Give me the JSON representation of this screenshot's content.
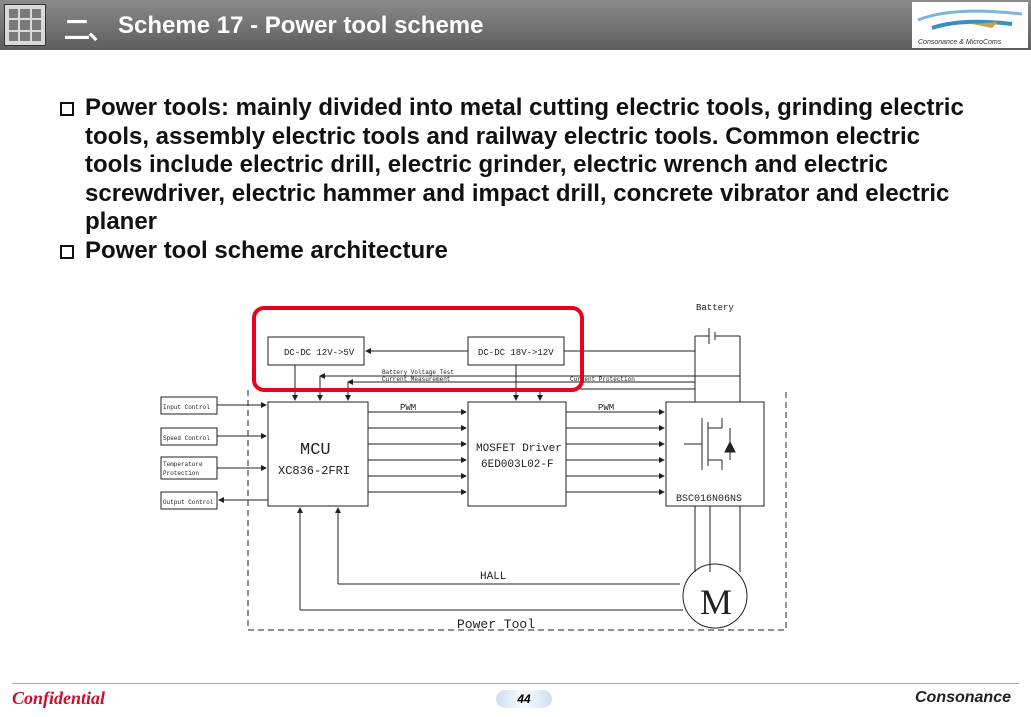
{
  "header": {
    "section_number": "二、",
    "title": "Scheme 17 - Power tool scheme",
    "logo_text": "Consonance & MicroComs"
  },
  "bullets": [
    "Power tools: mainly divided into metal cutting electric tools, grinding electric tools, assembly electric tools and railway electric tools. Common electric tools include electric drill, electric grinder, electric wrench and electric screwdriver, electric hammer and impact drill, concrete vibrator and electric planer",
    "Power tool scheme architecture"
  ],
  "diagram": {
    "battery": "Battery",
    "dcdc_5v": "DC-DC 12V->5V",
    "dcdc_12v": "DC-DC 18V->12V",
    "battery_voltage": "Battery Voltage Test",
    "current_measurement": "Current Measurement",
    "current_protection": "Current Protection",
    "inputs": [
      "Input Control",
      "Speed Control",
      "Temperature",
      "Protection",
      "Output Control"
    ],
    "pwm_left": "PWM",
    "pwm_right": "PWM",
    "mcu_title": "MCU",
    "mcu_part": "XC836-2FRI",
    "driver_title": "MOSFET Driver",
    "driver_part": "6ED003L02-F",
    "mosfet_part": "BSC016N06NS",
    "motor": "M",
    "hall": "HALL",
    "power_tool": "Power Tool"
  },
  "footer": {
    "confidential": "Confidential",
    "page_number": "44",
    "brand": "Consonance"
  },
  "colors": {
    "highlight": "#e8001c",
    "header_bg": "#6e6e6e",
    "confidential": "#c8102e"
  }
}
